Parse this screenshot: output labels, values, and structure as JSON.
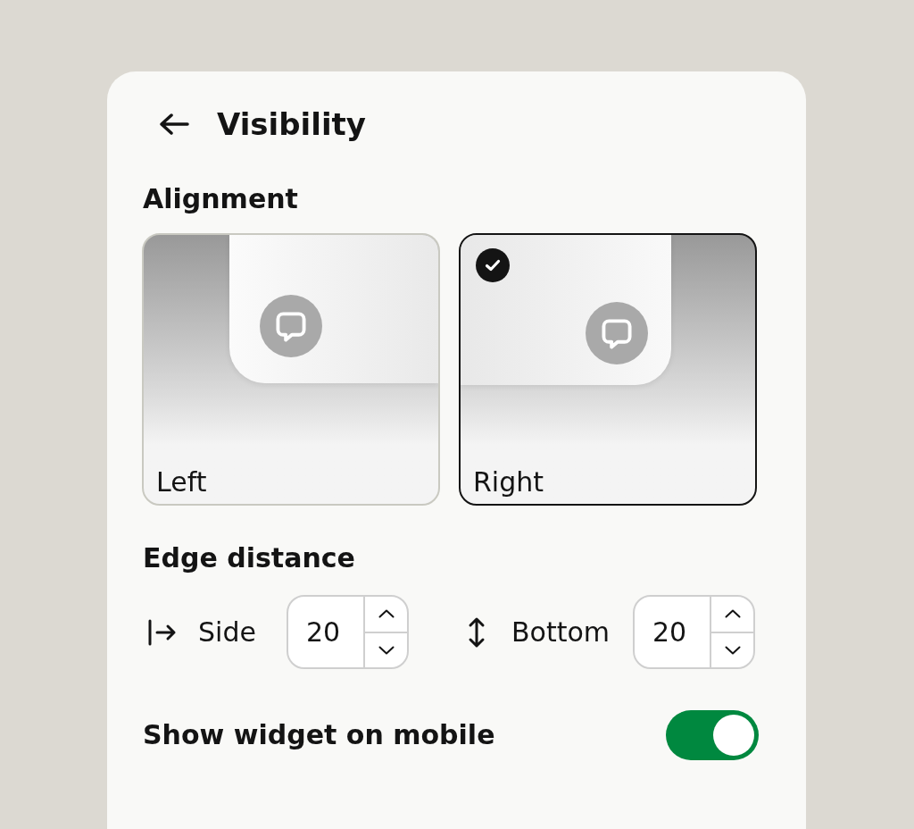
{
  "header": {
    "title": "Visibility"
  },
  "alignment": {
    "heading": "Alignment",
    "options": [
      {
        "label": "Left",
        "kind": "left",
        "selected": false
      },
      {
        "label": "Right",
        "kind": "right",
        "selected": true
      }
    ]
  },
  "edge_distance": {
    "heading": "Edge distance",
    "fields": [
      {
        "kind": "side",
        "label": "Side",
        "value": "20"
      },
      {
        "kind": "bottom",
        "label": "Bottom",
        "value": "20"
      }
    ]
  },
  "mobile": {
    "label": "Show widget on mobile",
    "on": true
  }
}
